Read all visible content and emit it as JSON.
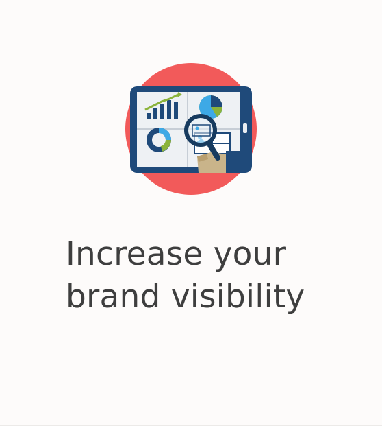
{
  "headline": {
    "line1": "Increase your",
    "line2": "brand visibility"
  },
  "illustration": {
    "icon": "tablet-analytics-magnifier-icon",
    "colors": {
      "circle": "#f25a5a",
      "tablet_frame": "#1f4a7a",
      "screen": "#eef1f4",
      "accent_green": "#8bb33a",
      "accent_blue": "#3da9e6",
      "dark_navy": "#173b5f",
      "hand": "#c9b48a"
    }
  }
}
